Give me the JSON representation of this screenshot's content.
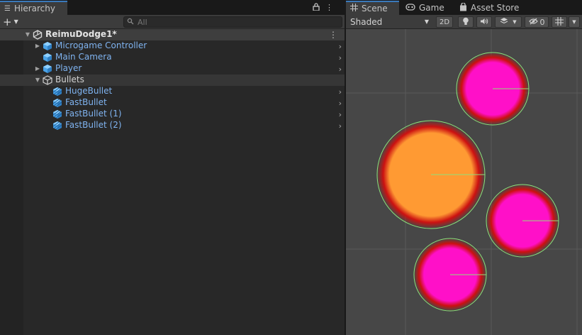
{
  "hierarchy": {
    "tab_title": "Hierarchy",
    "search_placeholder": "All",
    "scene_name": "ReimuDodge1*",
    "items": [
      {
        "label": "Microgame Controller",
        "kind": "prefab"
      },
      {
        "label": "Main Camera",
        "kind": "prefab"
      },
      {
        "label": "Player",
        "kind": "prefab"
      },
      {
        "label": "Bullets",
        "kind": "plain"
      },
      {
        "label": "HugeBullet",
        "kind": "prefab-variant"
      },
      {
        "label": "FastBullet",
        "kind": "prefab-variant"
      },
      {
        "label": "FastBullet (1)",
        "kind": "prefab-variant"
      },
      {
        "label": "FastBullet (2)",
        "kind": "prefab-variant"
      }
    ]
  },
  "scene_view": {
    "tabs": [
      {
        "label": "Scene",
        "icon": "grid-icon",
        "active": true
      },
      {
        "label": "Game",
        "icon": "gamepad-icon",
        "active": false
      },
      {
        "label": "Asset Store",
        "icon": "bag-icon",
        "active": false
      }
    ],
    "shading_mode": "Shaded",
    "mode_2d_label": "2D",
    "hidden_count": "0",
    "colors": {
      "grid_line": "#5a5a5a",
      "collider_outline": "#8fe07a",
      "huge_bullet_core": "#ff9a33",
      "huge_bullet_rim": "#cc1111",
      "fast_bullet_core": "#ff10c8",
      "fast_bullet_rim": "#cc1010"
    },
    "bullets": [
      "huge",
      "fast",
      "fast",
      "fast"
    ]
  }
}
